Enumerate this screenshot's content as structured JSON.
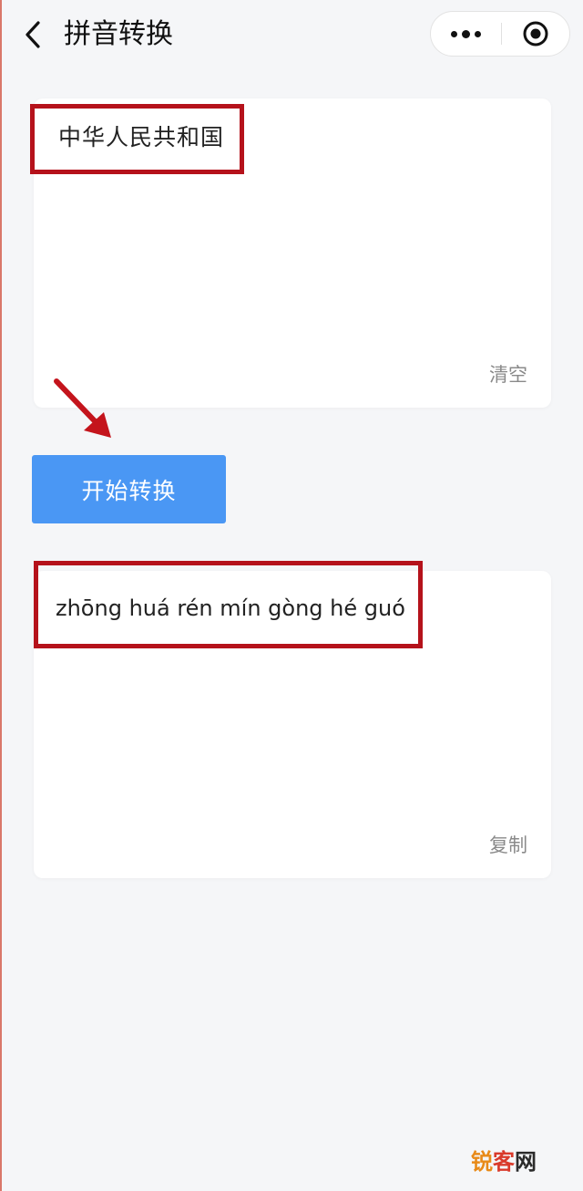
{
  "header": {
    "title": "拼音转换",
    "back_icon": "chevron-left-icon",
    "more_icon": "more-dots-icon",
    "target_icon": "target-circle-icon"
  },
  "input_card": {
    "text": "中华人民共和国",
    "clear_label": "清空"
  },
  "convert_button": {
    "label": "开始转换",
    "color": "#4a97f4"
  },
  "output_card": {
    "text": "zhōng huá rén mín gòng hé guó",
    "copy_label": "复制"
  },
  "annotations": {
    "highlight_color": "#b5121b"
  },
  "watermark": {
    "part1": "锐",
    "part2": "客",
    "part3": "网"
  }
}
